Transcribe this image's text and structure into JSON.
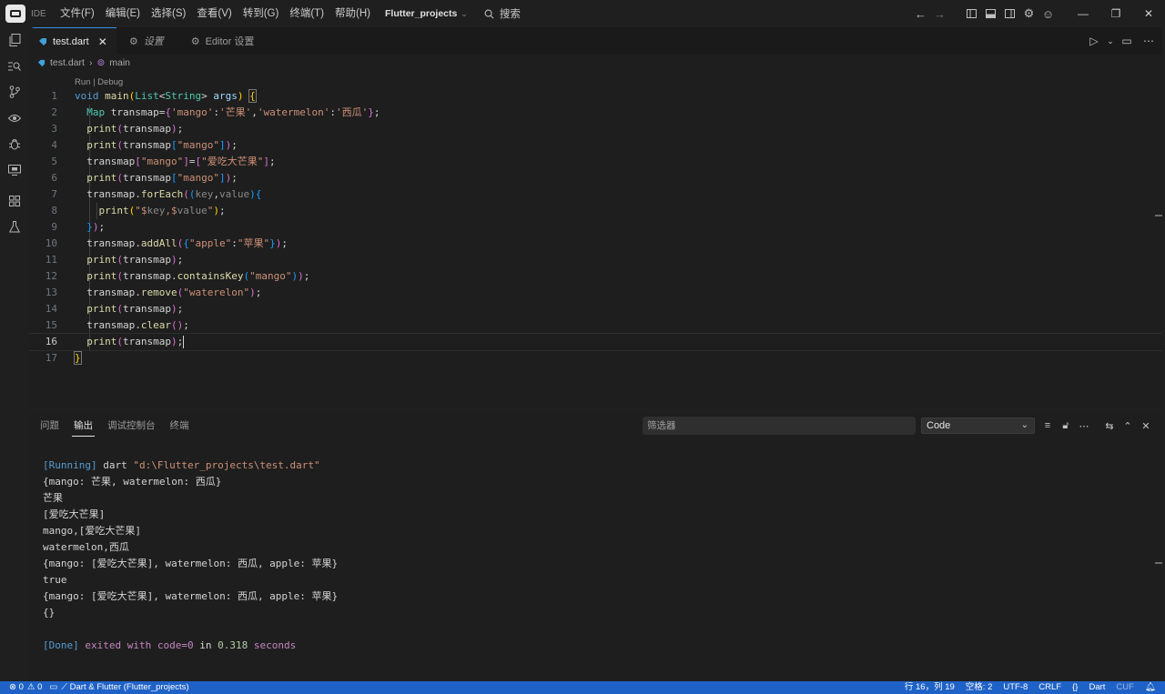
{
  "titlebar": {
    "ide_label": "IDE",
    "menu": [
      "文件(F)",
      "编辑(E)",
      "选择(S)",
      "查看(V)",
      "转到(G)",
      "终端(T)",
      "帮助(H)"
    ],
    "project": "Flutter_projects",
    "search": "搜索"
  },
  "tabs": [
    {
      "label": "test.dart",
      "active": true
    },
    {
      "label": "设置",
      "active": false
    },
    {
      "label": "Editor 设置",
      "active": false
    }
  ],
  "breadcrumb": {
    "file": "test.dart",
    "symbol": "main"
  },
  "codelens": "Run | Debug",
  "code_lines": [
    "void main(List<String> args) {",
    "  Map transmap={'mango':'芒果','watermelon':'西瓜'};",
    "  print(transmap);",
    "  print(transmap[\"mango\"]);",
    "  transmap[\"mango\"]=[\"爱吃大芒果\"];",
    "  print(transmap[\"mango\"]);",
    "  transmap.forEach((key,value){",
    "    print(\"$key,$value\");",
    "  });",
    "  transmap.addAll({\"apple\":\"苹果\"});",
    "  print(transmap);",
    "  print(transmap.containsKey(\"mango\"));",
    "  transmap.remove(\"waterelon\");",
    "  print(transmap);",
    "  transmap.clear();",
    "  print(transmap);",
    "}"
  ],
  "current_line": 16,
  "panel": {
    "tabs": [
      "问题",
      "输出",
      "调试控制台",
      "终端"
    ],
    "active_tab": "输出",
    "filter_placeholder": "筛选器",
    "channel": "Code"
  },
  "output": {
    "running_tag": "[Running]",
    "running_cmd": " dart ",
    "running_path": "\"d:\\Flutter_projects\\test.dart\"",
    "lines": [
      "{mango: 芒果, watermelon: 西瓜}",
      "芒果",
      "[爱吃大芒果]",
      "mango,[爱吃大芒果]",
      "watermelon,西瓜",
      "{mango: [爱吃大芒果], watermelon: 西瓜, apple: 苹果}",
      "true",
      "{mango: [爱吃大芒果], watermelon: 西瓜, apple: 苹果}",
      "{}"
    ],
    "done_tag": "[Done]",
    "done_text": " exited with ",
    "done_code": "code=0",
    "done_in": " in ",
    "done_time": "0.318",
    "done_seconds": " seconds"
  },
  "statusbar": {
    "errors": "0",
    "warnings": "0",
    "workspace": "Dart & Flutter (Flutter_projects)",
    "position": "行 16，列 19",
    "spaces": "空格: 2",
    "encoding": "UTF-8",
    "eol": "CRLF",
    "braces": "{}",
    "language": "Dart",
    "extra": "CUF"
  },
  "colors": {
    "accent": "#1f62c7",
    "background": "#1e1e1e"
  }
}
